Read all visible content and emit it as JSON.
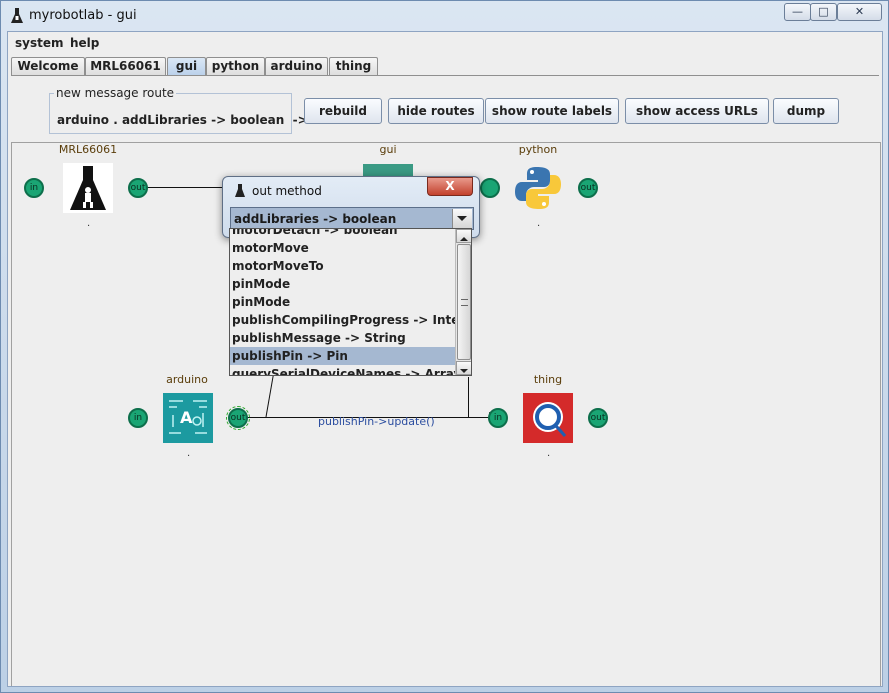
{
  "window": {
    "title": "myrobotlab - gui",
    "min_label": "—",
    "max_label": "□",
    "close_label": "✕"
  },
  "menu": {
    "system": "system",
    "help": "help"
  },
  "tabs": [
    "Welcome",
    "MRL66061",
    "gui",
    "python",
    "arduino",
    "thing"
  ],
  "route": {
    "legend": "new message route",
    "text": "arduino . addLibraries -> boolean  ->"
  },
  "toolbar": {
    "rebuild": "rebuild",
    "hide_routes": "hide routes",
    "show_route_labels": "show route labels",
    "show_access_urls": "show access URLs",
    "dump": "dump"
  },
  "services": {
    "mrl": {
      "name": "MRL66061",
      "dot": "."
    },
    "gui": {
      "name": "gui"
    },
    "python": {
      "name": "python",
      "dot": "."
    },
    "arduino": {
      "name": "arduino",
      "dot": "."
    },
    "thing": {
      "name": "thing",
      "dot": "."
    }
  },
  "ports": {
    "in": "in",
    "out": "out"
  },
  "route_label": "publishPin->update()",
  "dialog": {
    "title": "out method",
    "close_label": "X",
    "selected_value": "addLibraries -> boolean",
    "options": [
      "motorDetach -> boolean",
      "motorMove",
      "motorMoveTo",
      "pinMode",
      "pinMode",
      "publishCompilingProgress -> Integer",
      "publishMessage -> String",
      "publishPin -> Pin",
      "querySerialDeviceNames -> ArrayList"
    ],
    "highlighted_option": "publishPin -> Pin"
  },
  "colors": {
    "port_green": "#1aa574",
    "selection_blue": "#a5b8d1",
    "thing_red": "#d42a2a",
    "arduino_teal": "#1c9aa0",
    "python_blue": "#3a75b0",
    "python_yellow": "#f8c83a"
  }
}
